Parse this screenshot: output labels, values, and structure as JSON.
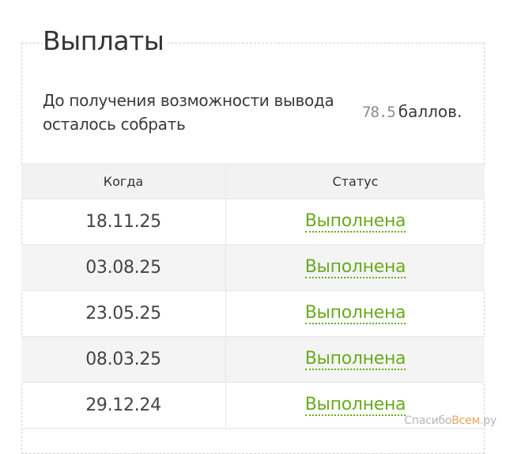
{
  "page": {
    "title": "Выплаты"
  },
  "balance": {
    "text": "До получения возможности вывода осталось собрать",
    "value": "78.5",
    "unit": "баллов."
  },
  "table": {
    "headers": {
      "date": "Когда",
      "status": "Статус"
    },
    "rows": [
      {
        "date": "18.11.25",
        "status": "Выполнена"
      },
      {
        "date": "03.08.25",
        "status": "Выполнена"
      },
      {
        "date": "23.05.25",
        "status": "Выполнена"
      },
      {
        "date": "08.03.25",
        "status": "Выполнена"
      },
      {
        "date": "29.12.24",
        "status": "Выполнена"
      }
    ]
  },
  "watermark": {
    "prefix": "Спасибо",
    "accent": "Всем",
    "suffix": ".ру"
  },
  "colors": {
    "link": "#6aaa1e",
    "header_bg": "#f2f2f2",
    "alt_row_bg": "#f4f4f4"
  }
}
